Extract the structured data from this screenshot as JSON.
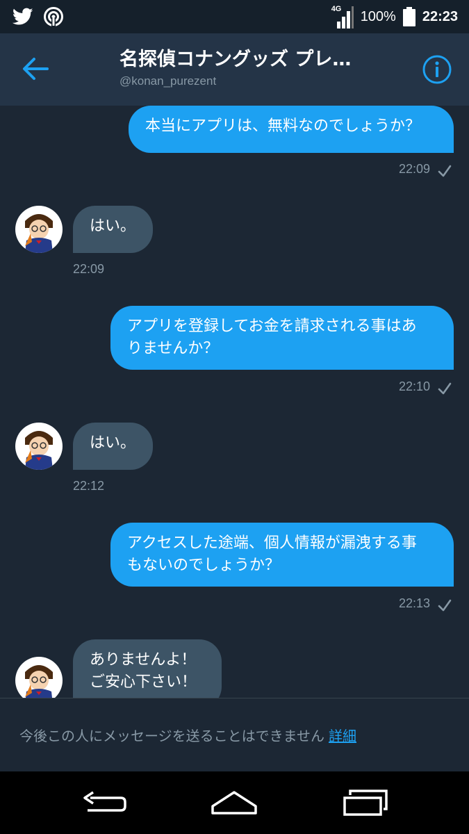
{
  "status_bar": {
    "network_type": "4G",
    "battery_percent": "100%",
    "time": "22:23",
    "icons": [
      "twitter-icon",
      "hotspot-icon",
      "signal-icon",
      "battery-icon"
    ]
  },
  "header": {
    "title": "名探偵コナングッズ プレ…",
    "handle": "@konan_purezent",
    "icons": [
      "back-arrow-icon",
      "info-icon"
    ]
  },
  "colors": {
    "background": "#1c2734",
    "header": "#243447",
    "outgoing_bubble": "#1da1f2",
    "incoming_bubble": "#3d5466",
    "muted_text": "#8899a6",
    "link": "#1da1f2"
  },
  "messages": [
    {
      "direction": "outgoing",
      "lines": [
        "本当にアプリは、無料なのでしょうか？"
      ],
      "time": "22:09",
      "status_icon": "check-icon"
    },
    {
      "direction": "incoming",
      "lines": [
        "はい。"
      ],
      "time": "22:09"
    },
    {
      "direction": "outgoing",
      "lines": [
        "アプリを登録してお金を請求される事はあ",
        "りませんか？"
      ],
      "time": "22:10",
      "status_icon": "check-icon"
    },
    {
      "direction": "incoming",
      "lines": [
        "はい。"
      ],
      "time": "22:12"
    },
    {
      "direction": "outgoing",
      "lines": [
        "アクセスした途端、個人情報が漏洩する事",
        "もないのでしょうか？"
      ],
      "time": "22:13",
      "status_icon": "check-icon"
    },
    {
      "direction": "incoming",
      "lines": [
        "ありませんよ！",
        "ご安心下さい！"
      ],
      "time": ""
    }
  ],
  "notice": {
    "text": "今後この人にメッセージを送ることはできません",
    "link_label": "詳細"
  },
  "nav_bar": {
    "icons": [
      "back-nav-icon",
      "home-nav-icon",
      "recents-nav-icon"
    ]
  }
}
